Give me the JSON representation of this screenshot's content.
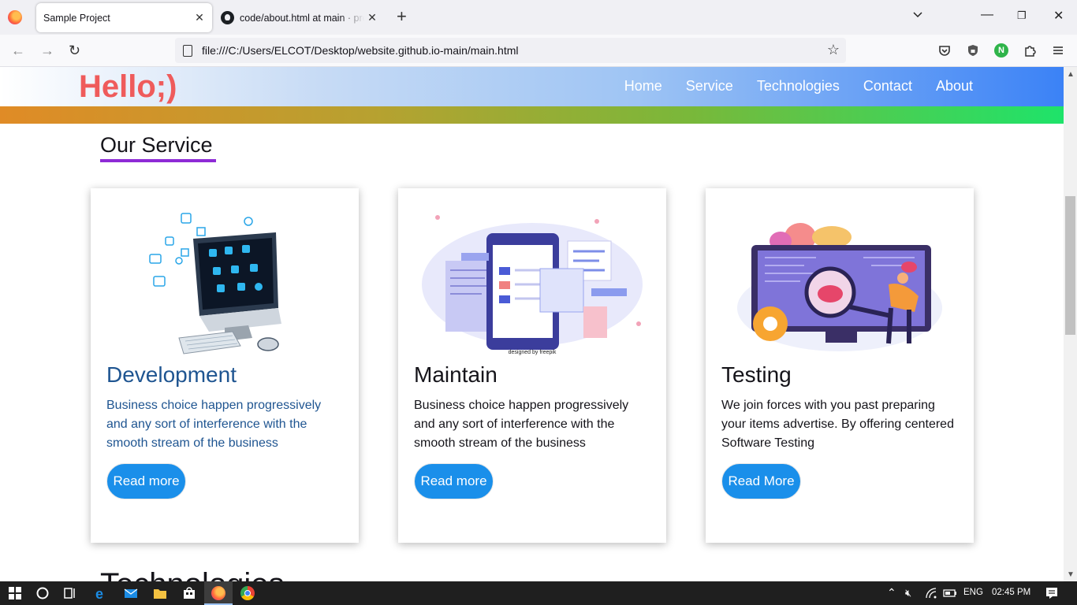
{
  "browser": {
    "tabs": [
      {
        "label": "Sample Project",
        "active": true
      },
      {
        "label": "code/about.html at main · premkumar",
        "active": false
      }
    ],
    "url": "file:///C:/Users/ELCOT/Desktop/website.github.io-main/main.html"
  },
  "site": {
    "logo": "Hello;)",
    "nav": [
      "Home",
      "Service",
      "Technologies",
      "Contact",
      "About"
    ],
    "section_title": "Our Service",
    "cards": [
      {
        "title": "Development",
        "desc": "Business choice happen progressively and any sort of interference with the smooth stream of the business",
        "button": "Read more"
      },
      {
        "title": "Maintain",
        "desc": "Business choice happen progressively and any sort of interference with the smooth stream of the business",
        "button": "Read more"
      },
      {
        "title": "Testing",
        "desc": "We join forces with you past preparing your items advertise. By offering centered Software Testing",
        "button": "Read More"
      }
    ],
    "next_section_title": "Technologies",
    "freepik_credit": "designed by freepik"
  },
  "taskbar": {
    "language": "ENG",
    "time": "02:45 PM"
  },
  "colors": {
    "logo": "#ef5b5b",
    "button": "#1a8fea",
    "title_underline": "#8e2bd6",
    "dev_text": "#1f5591"
  }
}
